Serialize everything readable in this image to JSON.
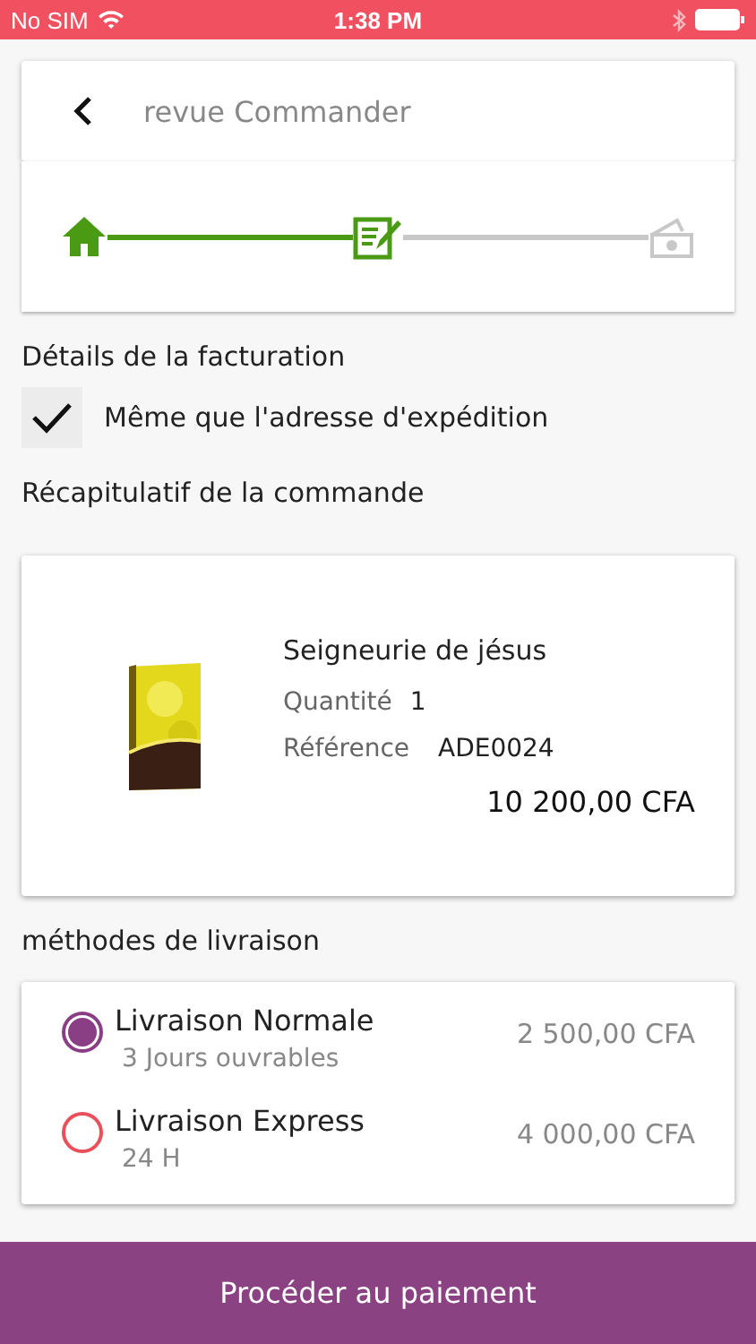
{
  "status_bar": {
    "carrier": "No SIM",
    "time": "1:38 PM"
  },
  "header": {
    "title": "revue Commander"
  },
  "steps": [
    {
      "kind": "home",
      "done": true
    },
    {
      "kind": "edit",
      "done": true
    },
    {
      "kind": "payment",
      "done": false
    }
  ],
  "billing": {
    "heading": "Détails de la facturation",
    "same_as_shipping": {
      "label": "Même que l'adresse d'expédition",
      "checked": true
    }
  },
  "summary": {
    "heading": "Récapitulatif de la commande",
    "product": {
      "name": "Seigneurie de jésus",
      "quantity_label": "Quantité",
      "quantity": "1",
      "reference_label": "Référence",
      "reference": "ADE0024",
      "price": "10 200,00 CFA"
    }
  },
  "delivery": {
    "heading": "méthodes de livraison",
    "options": [
      {
        "name": "Livraison Normale",
        "detail": "3 Jours ouvrables",
        "price": "2 500,00 CFA",
        "selected": true
      },
      {
        "name": "Livraison Express",
        "detail": "24 H",
        "price": "4 000,00 CFA",
        "selected": false
      }
    ]
  },
  "proceed_button": "Procéder au paiement"
}
